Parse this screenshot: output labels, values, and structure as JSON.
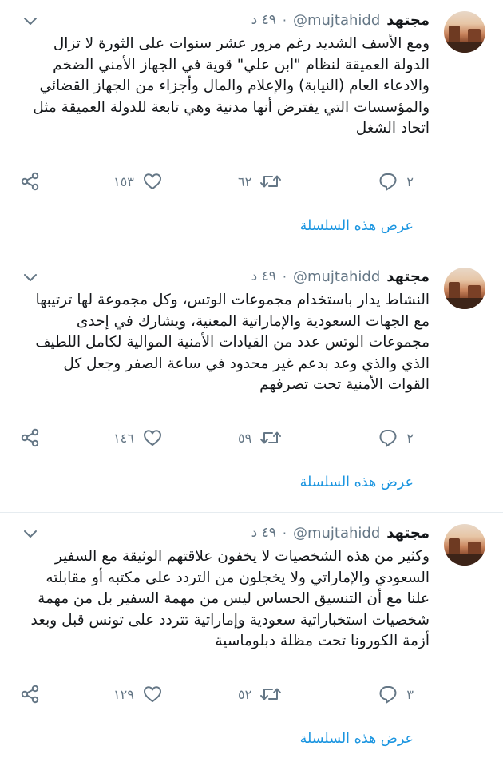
{
  "tweets": [
    {
      "name": "مجتهد",
      "handle": "@mujtahidd",
      "separator": "·",
      "time": "٤٩ د",
      "text": "ومع الأسف الشديد رغم مرور عشر سنوات على الثورة لا تزال الدولة العميقة لنظام \"ابن علي\" قوية في الجهاز الأمني الضخم والادعاء العام (النيابة) والإعلام والمال وأجزاء من الجهاز القضائي والمؤسسات التي يفترض أنها مدنية وهي تابعة للدولة العميقة مثل اتحاد الشغل",
      "replies": "٢",
      "retweets": "٦٢",
      "likes": "١٥٣",
      "show_thread": "عرض هذه السلسلة"
    },
    {
      "name": "مجتهد",
      "handle": "@mujtahidd",
      "separator": "·",
      "time": "٤٩ د",
      "text": "النشاط يدار باستخدام مجموعات الوتس، وكل مجموعة لها ترتيبها مع الجهات السعودية والإماراتية المعنية، ويشارك في إحدى مجموعات الوتس  عدد من القيادات الأمنية الموالية لكامل اللطيف الذي والذي وعد بدعم غير محدود في ساعة الصفر وجعل كل القوات الأمنية تحت تصرفهم",
      "replies": "٢",
      "retweets": "٥٩",
      "likes": "١٤٦",
      "show_thread": "عرض هذه السلسلة"
    },
    {
      "name": "مجتهد",
      "handle": "@mujtahidd",
      "separator": "·",
      "time": "٤٩ د",
      "text": "وكثير من هذه الشخصيات لا يخفون علاقتهم الوثيقة مع السفير السعودي والإماراتي ولا يخجلون من التردد على مكتبه أو مقابلته علنا مع أن التنسيق الحساس ليس من مهمة السفير بل من مهمة شخصيات استخباراتية سعودية وإماراتية تتردد على تونس قبل وبعد أزمة الكورونا تحت مظلة دبلوماسية",
      "replies": "٣",
      "retweets": "٥٢",
      "likes": "١٢٩",
      "show_thread": "عرض هذه السلسلة"
    }
  ],
  "icons": {
    "reply": "reply-icon",
    "retweet": "retweet-icon",
    "like": "heart-icon",
    "share": "share-icon",
    "menu": "chevron-down-icon"
  },
  "colors": {
    "text": "#14171a",
    "secondary": "#657786",
    "link": "#1b95e0",
    "divider": "#e6ecf0"
  }
}
